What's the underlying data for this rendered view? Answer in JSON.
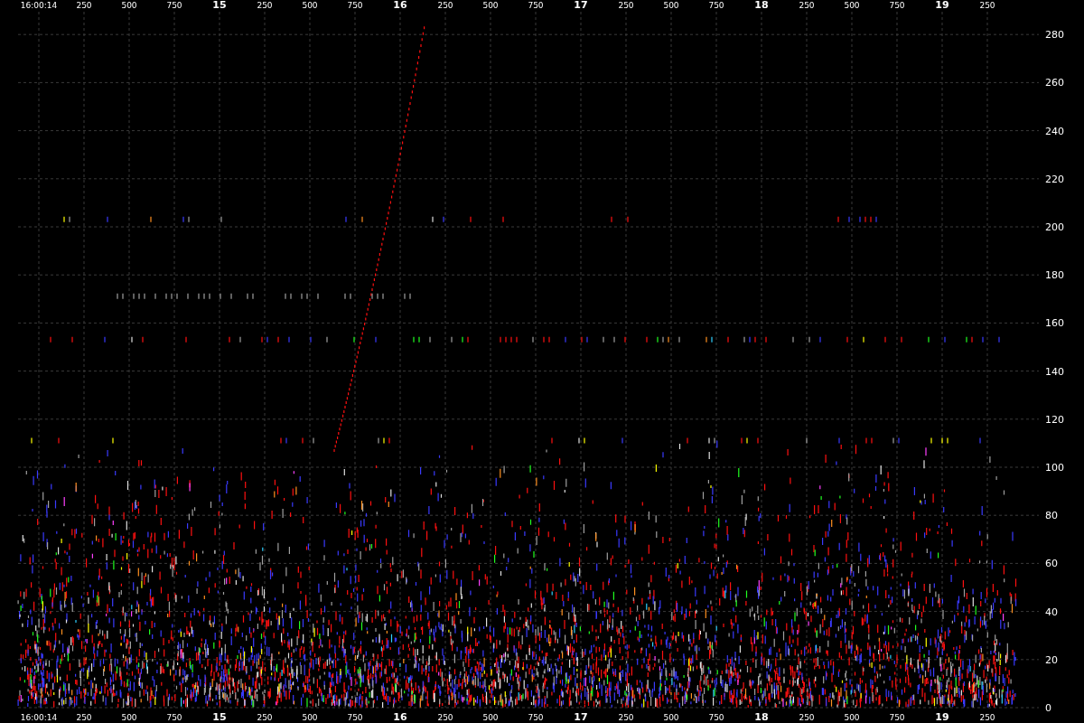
{
  "chart": {
    "top_axis_labels": [
      {
        "text": "16:00:14",
        "kind": "minor"
      },
      {
        "text": "250",
        "kind": "minor"
      },
      {
        "text": "500",
        "kind": "minor"
      },
      {
        "text": "750",
        "kind": "minor"
      },
      {
        "text": "15",
        "kind": "major"
      },
      {
        "text": "250",
        "kind": "minor"
      },
      {
        "text": "500",
        "kind": "minor"
      },
      {
        "text": "750",
        "kind": "minor"
      },
      {
        "text": "16",
        "kind": "major"
      },
      {
        "text": "250",
        "kind": "minor"
      },
      {
        "text": "500",
        "kind": "minor"
      },
      {
        "text": "750",
        "kind": "minor"
      },
      {
        "text": "17",
        "kind": "major"
      },
      {
        "text": "250",
        "kind": "minor"
      },
      {
        "text": "500",
        "kind": "minor"
      },
      {
        "text": "750",
        "kind": "minor"
      },
      {
        "text": "18",
        "kind": "major"
      },
      {
        "text": "250",
        "kind": "minor"
      },
      {
        "text": "500",
        "kind": "minor"
      },
      {
        "text": "750",
        "kind": "minor"
      },
      {
        "text": "19",
        "kind": "major"
      },
      {
        "text": "250",
        "kind": "minor"
      }
    ],
    "y_axis_labels": [
      "280",
      "260",
      "240",
      "220",
      "200",
      "180",
      "160",
      "140",
      "120",
      "100",
      "80",
      "60",
      "40",
      "20",
      "0"
    ],
    "bottom_axis_labels": [
      {
        "text": "16:00:14",
        "kind": "minor"
      },
      {
        "text": "250",
        "kind": "minor"
      },
      {
        "text": "500",
        "kind": "minor"
      },
      {
        "text": "750",
        "kind": "minor"
      },
      {
        "text": "15",
        "kind": "major"
      },
      {
        "text": "250",
        "kind": "minor"
      },
      {
        "text": "500",
        "kind": "minor"
      },
      {
        "text": "750",
        "kind": "minor"
      },
      {
        "text": "16",
        "kind": "major"
      },
      {
        "text": "250",
        "kind": "minor"
      },
      {
        "text": "500",
        "kind": "minor"
      },
      {
        "text": "750",
        "kind": "minor"
      },
      {
        "text": "17",
        "kind": "major"
      },
      {
        "text": "250",
        "kind": "minor"
      },
      {
        "text": "500",
        "kind": "minor"
      },
      {
        "text": "750",
        "kind": "minor"
      },
      {
        "text": "18",
        "kind": "major"
      },
      {
        "text": "250",
        "kind": "minor"
      },
      {
        "text": "500",
        "kind": "minor"
      },
      {
        "text": "750",
        "kind": "minor"
      },
      {
        "text": "19",
        "kind": "major"
      },
      {
        "text": "250",
        "kind": "minor"
      }
    ]
  }
}
